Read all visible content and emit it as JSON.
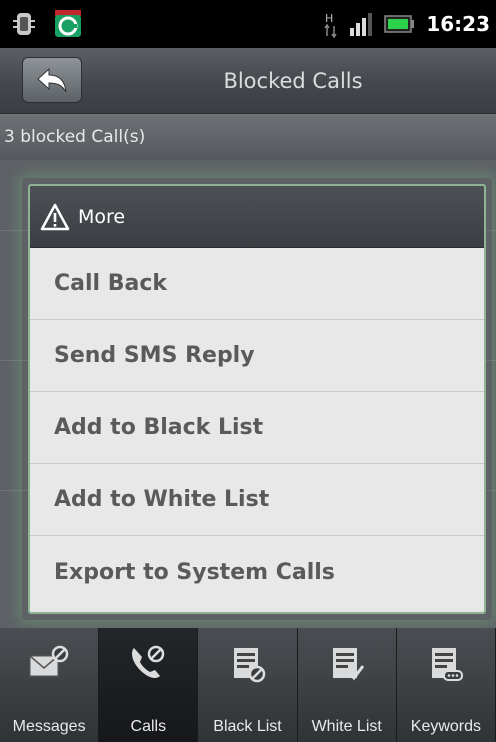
{
  "status_bar": {
    "time": "16:23",
    "icons": [
      "debug-icon",
      "app-icon",
      "network-h-icon",
      "signal-icon",
      "battery-icon"
    ]
  },
  "title_bar": {
    "back_icon": "back-arrow-icon",
    "title": "Blocked Calls"
  },
  "summary": {
    "count_text": "3 blocked Call(s)"
  },
  "dialog": {
    "icon": "warning-icon",
    "title": "More",
    "items": [
      {
        "label": "Call Back"
      },
      {
        "label": "Send SMS Reply"
      },
      {
        "label": "Add to Black List"
      },
      {
        "label": "Add to White List"
      },
      {
        "label": "Export to System Calls"
      }
    ]
  },
  "tabs": [
    {
      "label": "Messages",
      "icon": "messages-icon",
      "active": false
    },
    {
      "label": "Calls",
      "icon": "calls-icon",
      "active": true
    },
    {
      "label": "Black List",
      "icon": "black-list-icon",
      "active": false
    },
    {
      "label": "White List",
      "icon": "white-list-icon",
      "active": false
    },
    {
      "label": "Keywords",
      "icon": "keywords-icon",
      "active": false
    }
  ],
  "colors": {
    "dialog_border": "#8fb493",
    "menu_text": "#5a5a5a",
    "title_text": "#d9dde0"
  }
}
